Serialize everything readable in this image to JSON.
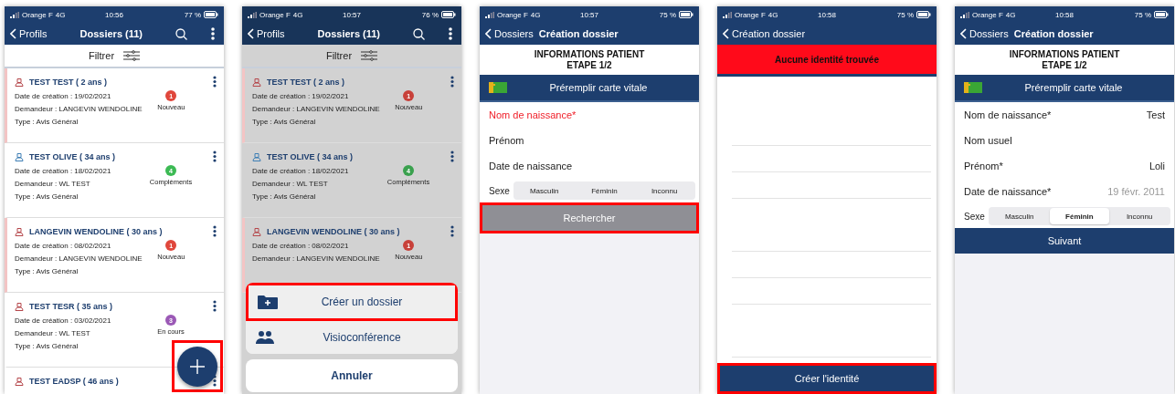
{
  "screens": [
    {
      "kind": "dossier_list",
      "dimmed": false,
      "status": {
        "carrier": "Orange F",
        "network": "4G",
        "time": "10:56",
        "battery": "77 %"
      },
      "nav": {
        "back": "Profils",
        "title": "Dossiers (11)",
        "search": true,
        "menu": true
      },
      "filter": "Filtrer",
      "dossiers": [
        {
          "name": "TEST TEST ( 2 ans )",
          "color": "#b5474b",
          "flagged": true,
          "lines": [
            "Date de création : 19/02/2021",
            "Demandeur : LANGEVIN WENDOLINE",
            "Type : Avis Général"
          ],
          "badge": {
            "count": "1",
            "label": "Nouveau",
            "color": "#e0473c"
          }
        },
        {
          "name": "TEST OLIVE ( 34 ans )",
          "color": "#3f7fb5",
          "flagged": false,
          "lines": [
            "Date de création : 18/02/2021",
            "Demandeur : WL TEST",
            "Type : Avis Général"
          ],
          "badge": {
            "count": "4",
            "label": "Compléments",
            "color": "#3cba54"
          }
        },
        {
          "name": "LANGEVIN WENDOLINE ( 30 ans )",
          "color": "#b5474b",
          "flagged": true,
          "lines": [
            "Date de création : 08/02/2021",
            "Demandeur : LANGEVIN WENDOLINE",
            "Type : Avis Général"
          ],
          "badge": {
            "count": "1",
            "label": "Nouveau",
            "color": "#e0473c"
          }
        },
        {
          "name": "TEST TESR ( 35 ans )",
          "color": "#b5474b",
          "flagged": false,
          "lines": [
            "Date de création : 03/02/2021",
            "Demandeur : WL TEST",
            "Type : Avis Général"
          ],
          "badge": {
            "count": "3",
            "label": "En cours",
            "color": "#9b59b6"
          }
        },
        {
          "name": "TEST EADSP ( 46 ans )",
          "color": "#b5474b",
          "flagged": false
        }
      ],
      "fab": {
        "outlined": true
      }
    },
    {
      "kind": "dossier_list",
      "dimmed": true,
      "status": {
        "carrier": "Orange F",
        "network": "4G",
        "time": "10:57",
        "battery": "76 %"
      },
      "nav": {
        "back": "Profils",
        "title": "Dossiers (11)",
        "search": true,
        "menu": true
      },
      "filter": "Filtrer",
      "dossiers": [
        {
          "name": "TEST TEST ( 2 ans )",
          "color": "#b5474b",
          "flagged": true,
          "lines": [
            "Date de création : 19/02/2021",
            "Demandeur : LANGEVIN WENDOLINE",
            "Type : Avis Général"
          ],
          "badge": {
            "count": "1",
            "label": "Nouveau",
            "color": "#c8413a"
          }
        },
        {
          "name": "TEST OLIVE ( 34 ans )",
          "color": "#3f7fb5",
          "flagged": false,
          "lines": [
            "Date de création : 18/02/2021",
            "Demandeur : WL TEST",
            "Type : Avis Général"
          ],
          "badge": {
            "count": "4",
            "label": "Compléments",
            "color": "#3aa14e"
          }
        },
        {
          "name": "LANGEVIN WENDOLINE ( 30 ans )",
          "color": "#b5474b",
          "flagged": true,
          "lines": [
            "Date de création : 08/02/2021",
            "Demandeur : LANGEVIN WENDOLINE"
          ],
          "badge": {
            "count": "1",
            "label": "Nouveau",
            "color": "#c8413a"
          }
        }
      ],
      "sheet": {
        "actions": [
          {
            "kind": "folder",
            "label": "Créer un dossier",
            "outlined": true
          },
          {
            "kind": "people",
            "label": "Visioconférence",
            "outlined": false
          }
        ],
        "cancel": "Annuler"
      }
    },
    {
      "kind": "identity_form",
      "status": {
        "carrier": "Orange F",
        "network": "4G",
        "time": "10:57",
        "battery": "75 %"
      },
      "nav": {
        "back": "Dossiers",
        "title": "Création dossier"
      },
      "heading": [
        "INFORMATIONS PATIENT",
        "ETAPE 1/2"
      ],
      "prefill": "Préremplir carte vitale",
      "fields": [
        {
          "label": "Nom de naissance*",
          "error": true
        },
        {
          "label": "Prénom",
          "error": false
        },
        {
          "label": "Date de naissance",
          "error": false
        }
      ],
      "sex": {
        "label": "Sexe",
        "options": [
          {
            "label": "Masculin",
            "selected": false
          },
          {
            "label": "Féminin",
            "selected": false
          },
          {
            "label": "Inconnu",
            "selected": false
          }
        ]
      },
      "submit": {
        "label": "Rechercher",
        "disabled": true,
        "outlined": true
      }
    },
    {
      "kind": "search_results",
      "status": {
        "carrier": "Orange F",
        "network": "4G",
        "time": "10:58",
        "battery": "75 %"
      },
      "nav": {
        "back": "Création dossier"
      },
      "alert": "Aucune identité trouvée",
      "submit": {
        "label": "Créer l'identité",
        "disabled": false,
        "outlined": true
      }
    },
    {
      "kind": "identity_form",
      "status": {
        "carrier": "Orange F",
        "network": "4G",
        "time": "10:58",
        "battery": "75 %"
      },
      "nav": {
        "back": "Dossiers",
        "title": "Création dossier"
      },
      "heading": [
        "INFORMATIONS PATIENT",
        "ETAPE 1/2"
      ],
      "prefill": "Préremplir carte vitale",
      "fields": [
        {
          "label": "Nom de naissance*",
          "error": false,
          "value": "Test",
          "value_dimmed": false
        },
        {
          "label": "Nom usuel",
          "error": false
        },
        {
          "label": "Prénom*",
          "error": false,
          "value": "Loli",
          "value_dimmed": false
        },
        {
          "label": "Date de naissance*",
          "error": false,
          "value": "19 févr. 2011",
          "value_dimmed": true
        }
      ],
      "sex": {
        "label": "Sexe",
        "options": [
          {
            "label": "Masculin",
            "selected": false
          },
          {
            "label": "Féminin",
            "selected": true
          },
          {
            "label": "Inconnu",
            "selected": false
          }
        ]
      },
      "submit": {
        "label": "Suivant",
        "disabled": false,
        "outlined": false
      }
    }
  ]
}
